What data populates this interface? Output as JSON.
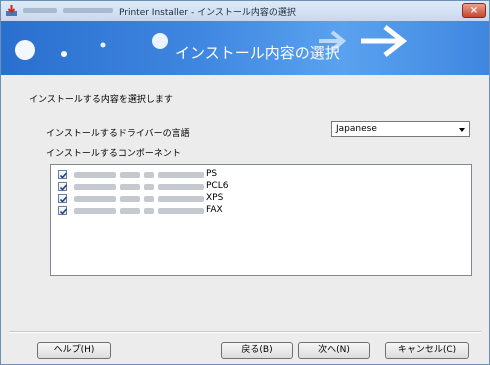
{
  "window": {
    "title": "Printer Installer - インストール内容の選択",
    "close_label": "×"
  },
  "banner": {
    "title": "インストール内容の選択"
  },
  "page": {
    "instruction": "インストールする内容を選択します",
    "language_label": "インストールするドライバーの言語",
    "language_selected": "Japanese",
    "components_label": "インストールするコンポーネント"
  },
  "components": [
    {
      "name": "PS",
      "checked": true
    },
    {
      "name": "PCL6",
      "checked": true
    },
    {
      "name": "XPS",
      "checked": true
    },
    {
      "name": "FAX",
      "checked": true
    }
  ],
  "buttons": {
    "help": "ヘルプ(H)",
    "back": "戻る(B)",
    "next": "次へ(N)",
    "cancel": "キャンセル(C)"
  },
  "colors": {
    "banner": "#3f86e0",
    "close": "#c9452c",
    "check": "#1f3f7a"
  }
}
